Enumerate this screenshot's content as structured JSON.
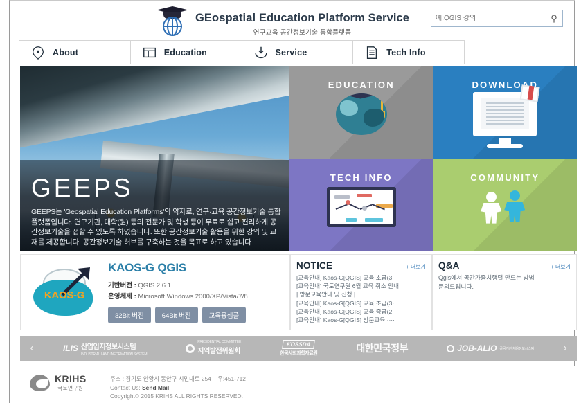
{
  "header": {
    "brand_bold": "GE",
    "brand_rest": "ospatial ",
    "brand_bold2": "E",
    "brand_rest2": "ducation ",
    "brand_bold3": "P",
    "brand_rest3": "latform ",
    "brand_bold4": "S",
    "brand_rest4": "ervice",
    "title_full": "GEospatial Education Platform Service",
    "subtitle": "연구교육 공간정보기술 통합플랫폼",
    "logo_icon": "graduation-cap-globe-icon",
    "search_placeholder": "예:QGIS 강의",
    "search_value": "",
    "search_icon": "search-icon"
  },
  "nav": {
    "items": [
      {
        "label": "About",
        "icon": "location-pin-icon"
      },
      {
        "label": "Education",
        "icon": "layout-grid-icon"
      },
      {
        "label": "Service",
        "icon": "download-tray-icon"
      },
      {
        "label": "Tech Info",
        "icon": "document-icon"
      }
    ]
  },
  "hero": {
    "title": "GEEPS",
    "description": "GEEPS는 'Geospatial Education Platforms'의 약자로, 연구·교육 공간정보기술 통합 플랫폼입니다. 연구기관, 대학(원) 등의 전문가 및 학생 등이 무료로 쉽고 편리하게 공간정보기술을 접할 수 있도록 하였습니다. 또한 공간정보기술 활용을 위한 강의 및 교재를 제공합니다. 공간정보기술 허브를 구축하는 것을 목표로 하고 있습니다"
  },
  "tiles": [
    {
      "label": "EDUCATION",
      "color": "#9a9a9a",
      "icon": "globe-graduation-cap-icon"
    },
    {
      "label": "DOWNLOAD",
      "color": "#2a7fc0",
      "icon": "monitor-document-icon"
    },
    {
      "label": "TECH INFO",
      "color": "#7d76c4",
      "icon": "chart-board-icon"
    },
    {
      "label": "COMMUNITY",
      "color": "#aacd6f",
      "icon": "two-people-icon"
    }
  ],
  "kaos": {
    "logo_text": "KAOS-G",
    "logo_icon": "kaos-g-globe-arrow-icon",
    "title": "KAOS-G QGIS",
    "base_version_label": "기반버전 :",
    "base_version_value": "QGIS 2.6.1",
    "os_label": "운영체제 :",
    "os_value": "Microsoft Windows 2000/XP/Vista/7/8",
    "buttons": [
      "32Bit 버전",
      "64Bit 버전",
      "교육용샘플"
    ]
  },
  "notice": {
    "title": "NOTICE",
    "more": "+ 더보기",
    "items": [
      "[교육안내] Kaos-G[QGIS] 교육 초급(3···",
      "[교육안내] 국토연구원 6월 교육 취소 안내",
      "| 방문교육안내 및 신청 |",
      "[교육안내] Kaos-G[QGIS] 교육 초급(3···",
      "[교육안내] Kaos-G[QGIS] 교육 중급(2···",
      "[교육안내] Kaos-G[QGIS] 방문교육 ····"
    ]
  },
  "qa": {
    "title": "Q&A",
    "more": "+ 더보기",
    "line1": "Qgis에서 공간가중치행렬 만드는 방법···",
    "line2": "문의드립니다."
  },
  "partners": {
    "prev_icon": "chevron-left-icon",
    "next_icon": "chevron-right-icon",
    "items": [
      {
        "mark": "ILIS",
        "name": "산업입지정보시스템",
        "sub": "INDUSTRIAL LAND INFORMATION SYSTEM",
        "icon": "ilis-logo-icon"
      },
      {
        "mark": "",
        "name": "지역발전위원회",
        "sub": "PRESIDENTIAL COMMITTEE",
        "icon": "regional-development-logo-icon"
      },
      {
        "mark": "KOSSDA",
        "name": "한국사회과학자료원",
        "sub": "",
        "icon": "kossda-logo-icon"
      },
      {
        "mark": "",
        "name": "대한민국정부",
        "sub": "",
        "icon": "korea-government-logo-icon"
      },
      {
        "mark": "JOB-ALIO",
        "name": "공공기관 채용정보시스템",
        "sub": "",
        "icon": "job-alio-logo-icon"
      }
    ]
  },
  "footer": {
    "org_name": "KRIHS",
    "org_sub": "국토연구원",
    "org_icon": "krihs-logo-icon",
    "address_label": "주소 :",
    "address": "경기도 안양시 동안구 시민대로 254",
    "zip": "우:451-712",
    "contact_label": "Contact Us:",
    "contact_link": "Send Mail",
    "copyright": "Copyright© 2015 KRIHS ALL RIGHTS RESERVED."
  }
}
